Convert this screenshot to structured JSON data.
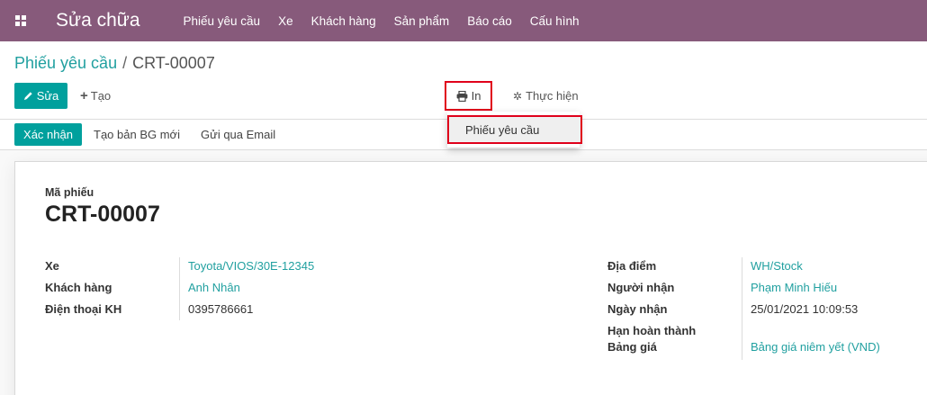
{
  "navbar": {
    "app_title": "Sửa chữa",
    "menu": [
      "Phiếu yêu cầu",
      "Xe",
      "Khách hàng",
      "Sản phẩm",
      "Báo cáo",
      "Cấu hình"
    ]
  },
  "breadcrumb": {
    "parent": "Phiếu yêu cầu",
    "separator": "/",
    "current": "CRT-00007"
  },
  "toolbar": {
    "edit_label": "Sửa",
    "create_label": "Tạo",
    "print_label": "In",
    "action_label": "Thực hiện"
  },
  "print_menu": {
    "items": [
      "Phiếu yêu cầu"
    ]
  },
  "statusbar": {
    "confirm_label": "Xác nhận",
    "new_quote_label": "Tạo bản BG mới",
    "email_label": "Gửi qua Email"
  },
  "form": {
    "code_label": "Mã phiếu",
    "code_value": "CRT-00007",
    "left_fields": [
      {
        "label": "Xe",
        "value": "Toyota/VIOS/30E-12345"
      },
      {
        "label": "Khách hàng",
        "value": "Anh Nhân"
      },
      {
        "label": "Điện thoại KH",
        "value": "0395786661"
      }
    ],
    "right_fields": [
      {
        "label": "Địa điểm",
        "value": "WH/Stock"
      },
      {
        "label": "Người nhận",
        "value": "Phạm Minh Hiếu"
      },
      {
        "label": "Ngày nhận",
        "value": "25/01/2021 10:09:53"
      },
      {
        "label": "Hạn hoàn thành",
        "value": ""
      },
      {
        "label": "Bảng giá",
        "value": "Bảng giá niêm yết (VND)"
      }
    ]
  },
  "colors": {
    "navbar": "#875a7b",
    "primary": "#00a09d",
    "link": "#21a0a0",
    "highlight": "#e0001b"
  }
}
